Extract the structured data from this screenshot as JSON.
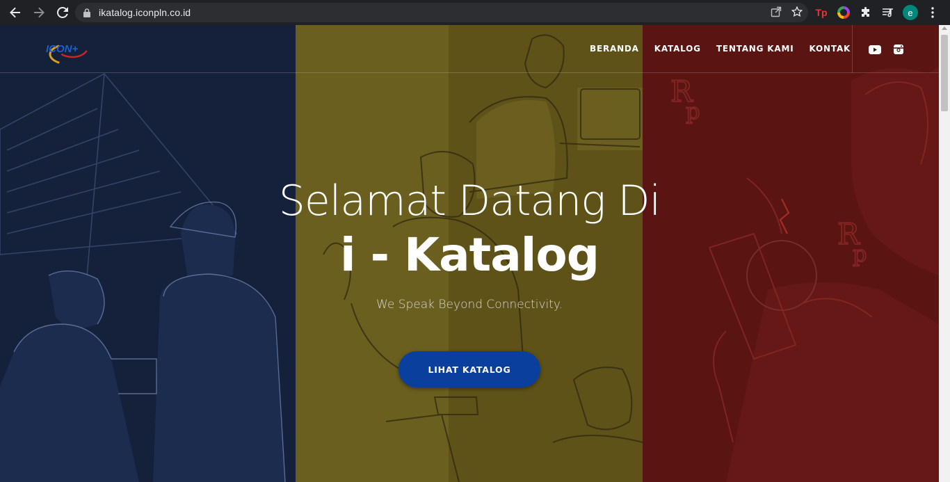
{
  "browser": {
    "url": "ikatalog.iconpln.co.id",
    "profile_initial": "e",
    "extensions": [
      {
        "icon": "tp-extension-icon",
        "label": "Tp"
      },
      {
        "icon": "color-wheel-extension-icon"
      },
      {
        "icon": "puzzle-extensions-icon"
      },
      {
        "icon": "media-queue-icon"
      }
    ]
  },
  "site": {
    "brand": "ICON+",
    "nav": {
      "items": [
        "BERANDA",
        "KATALOG",
        "TENTANG KAMI",
        "KONTAK"
      ]
    },
    "social": [
      "youtube-icon",
      "instagram-icon"
    ]
  },
  "hero": {
    "line1": "Selamat Datang Di",
    "line2": "i - Katalog",
    "tagline": "We Speak Beyond Connectivity.",
    "cta_label": "LIHAT KATALOG"
  },
  "colors": {
    "panel_blue": "#15203a",
    "panel_yellow": "#5e5218",
    "panel_red": "#5a1412",
    "cta": "#0b3f9e"
  }
}
